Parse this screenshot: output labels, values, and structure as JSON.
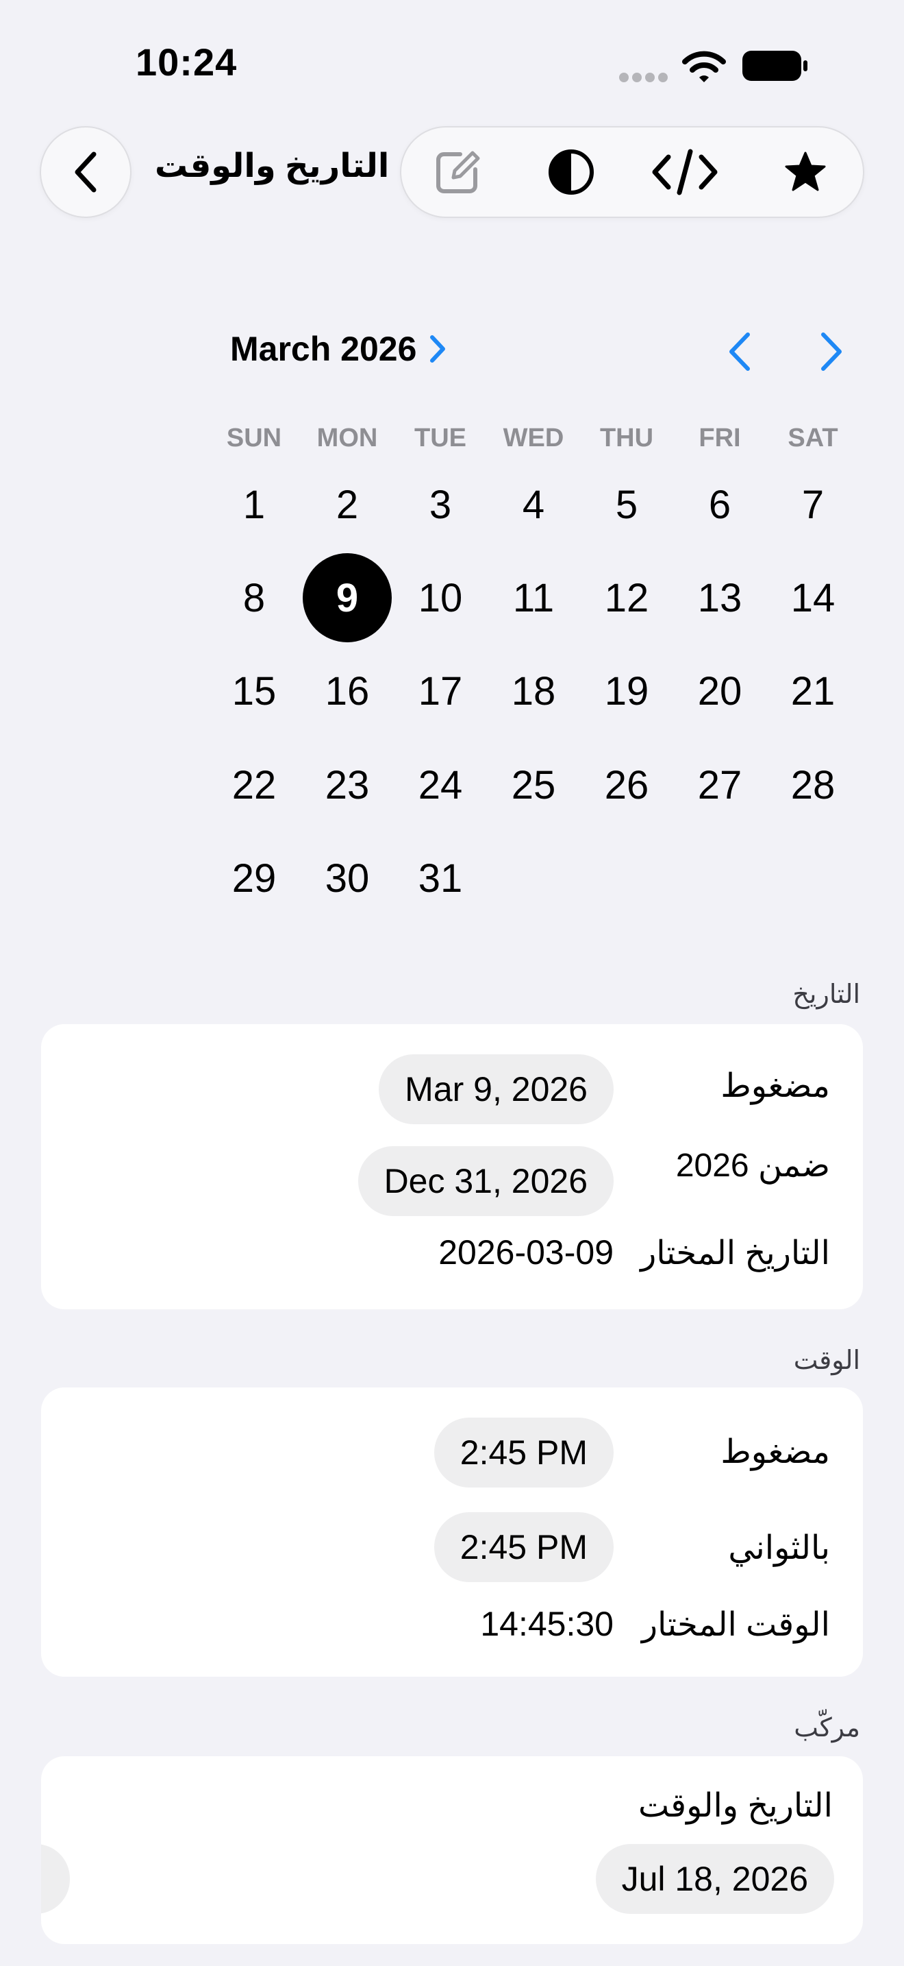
{
  "status_bar": {
    "time": "10:24"
  },
  "nav": {
    "title": "التاريخ والوقت"
  },
  "calendar": {
    "month_label": "March 2026",
    "weekdays": [
      "SUN",
      "MON",
      "TUE",
      "WED",
      "THU",
      "FRI",
      "SAT"
    ],
    "days": [
      "1",
      "2",
      "3",
      "4",
      "5",
      "6",
      "7",
      "8",
      "9",
      "10",
      "11",
      "12",
      "13",
      "14",
      "15",
      "16",
      "17",
      "18",
      "19",
      "20",
      "21",
      "22",
      "23",
      "24",
      "25",
      "26",
      "27",
      "28",
      "29",
      "30",
      "31"
    ],
    "selected_day": "9",
    "accent": "#1E88F5"
  },
  "date_section": {
    "header": "التاريخ",
    "compact_label": "مضغوط",
    "compact_value": "Mar 9, 2026",
    "within_label": "ضمن 2026",
    "within_value": "Dec 31, 2026",
    "selected_label": "التاريخ المختار",
    "selected_value": "2026-03-09"
  },
  "time_section": {
    "header": "الوقت",
    "compact_label": "مضغوط",
    "compact_value": "2:45 PM",
    "seconds_label": "بالثواني",
    "seconds_value": "2:45 PM",
    "selected_label": "الوقت المختار",
    "selected_value": "14:45:30"
  },
  "combined_section": {
    "header": "مركّب",
    "label": "التاريخ والوقت",
    "date_value": "Jul 18, 2026"
  }
}
